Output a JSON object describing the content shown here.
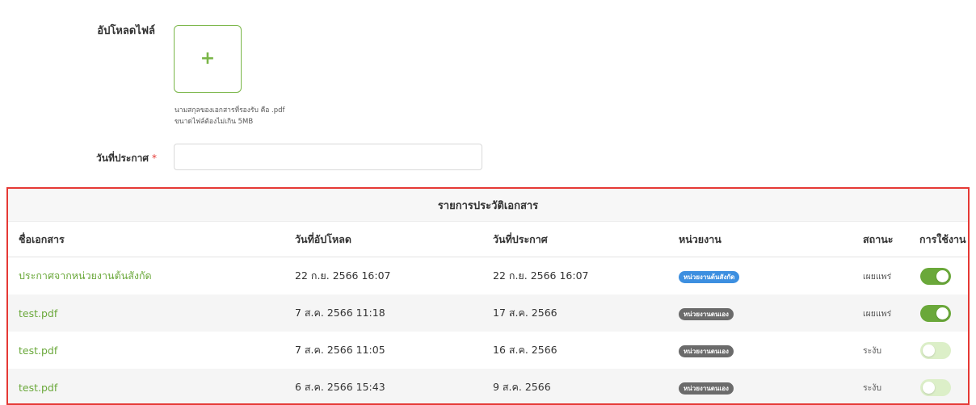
{
  "form": {
    "upload_label": "อัปโหลดไฟล์",
    "upload_hint_1": "นามสกุลของเอกสารที่รองรับ คือ .pdf",
    "upload_hint_2": "ขนาดไฟล์ต้องไม่เกิน 5MB",
    "date_label": "วันที่ประกาศ",
    "required_mark": "*",
    "date_value": ""
  },
  "history": {
    "title": "รายการประวัติเอกสาร",
    "columns": [
      "ชื่อเอกสาร",
      "วันที่อัปโหลด",
      "วันที่ประกาศ",
      "หน่วยงาน",
      "สถานะ",
      "การใช้งาน"
    ],
    "rows": [
      {
        "name": "ประกาศจากหน่วยงานต้นสังกัด",
        "uploaded": "22 ก.ย. 2566 16:07",
        "announced": "22 ก.ย. 2566 16:07",
        "unit": "หน่วยงานต้นสังกัด",
        "unit_color": "#3d8fe0",
        "status": "เผยแพร่",
        "enabled": "on"
      },
      {
        "name": "test.pdf",
        "uploaded": "7 ส.ค. 2566 11:18",
        "announced": "17 ส.ค. 2566",
        "unit": "หน่วยงานตนเอง",
        "unit_color": "#6b6b6b",
        "status": "เผยแพร่",
        "enabled": "on"
      },
      {
        "name": "test.pdf",
        "uploaded": "7 ส.ค. 2566 11:05",
        "announced": "16 ส.ค. 2566",
        "unit": "หน่วยงานตนเอง",
        "unit_color": "#6b6b6b",
        "status": "ระงับ",
        "enabled": "off"
      },
      {
        "name": "test.pdf",
        "uploaded": "6 ส.ค. 2566 15:43",
        "announced": "9 ส.ค. 2566",
        "unit": "หน่วยงานตนเอง",
        "unit_color": "#6b6b6b",
        "status": "ระงับ",
        "enabled": "off"
      }
    ]
  },
  "colors": {
    "accent_green": "#6aa83a",
    "toggle_on": "#6aa83a",
    "toggle_off": "#dcefc8",
    "highlight_border": "#e53935"
  },
  "icons": {
    "upload": "plus-icon"
  }
}
